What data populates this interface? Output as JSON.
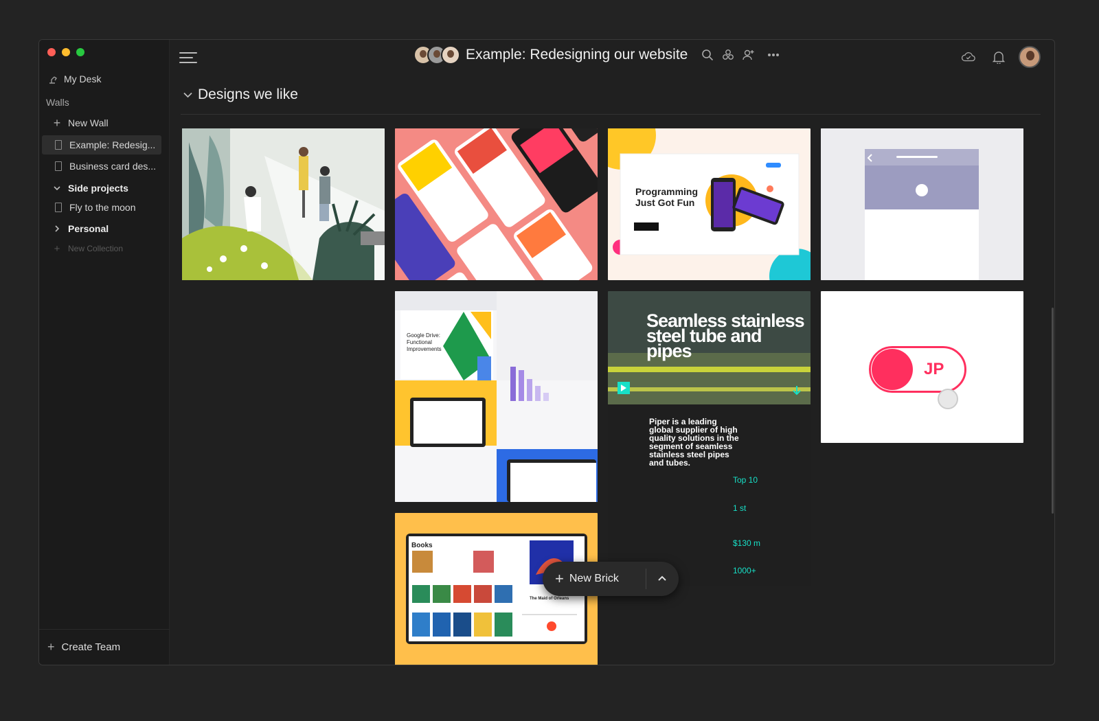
{
  "window": {
    "title": "Example: Redesigning our website",
    "controls": {
      "close": "#ff5f57",
      "minimize": "#febc2e",
      "maximize": "#28c840"
    }
  },
  "sidebar": {
    "my_desk": "My Desk",
    "walls_label": "Walls",
    "new_wall": "New Wall",
    "walls": [
      {
        "label": "Example: Redesig...",
        "active": true
      },
      {
        "label": "Business card des..."
      }
    ],
    "collections": [
      {
        "label": "Side projects",
        "expanded": true,
        "items": [
          {
            "label": "Fly to the moon"
          }
        ]
      },
      {
        "label": "Personal",
        "expanded": false
      }
    ],
    "new_collection": "New Collection",
    "create_team": "Create Team"
  },
  "section": {
    "title": "Designs we like"
  },
  "cards": {
    "programming": {
      "title": "Programming Just Got Fun"
    },
    "toggle": {
      "text": "JP"
    },
    "piper": {
      "headline": "Seamless stainless steel tube and pipes",
      "body": "Piper is a leading global supplier of high quality solutions in the segment of seamless stainless steel pipes and tubes.",
      "stats": [
        "Top 10",
        "1 st",
        "$130 m",
        "1000+"
      ]
    },
    "books": {
      "title": "Books",
      "subtitle": "The Maid of Orleans"
    },
    "drive": {
      "title": "Google Drive: Functional Improvements"
    }
  },
  "new_brick": {
    "label": "New Brick"
  },
  "icons": [
    "search-icon",
    "integrations-icon",
    "add-user-icon",
    "more-icon",
    "cloud-icon",
    "bell-icon",
    "hamburger-icon"
  ],
  "colors": {
    "bg": "#202020",
    "accent_pink": "#ff2f5e",
    "accent_teal": "#00d3c2"
  }
}
